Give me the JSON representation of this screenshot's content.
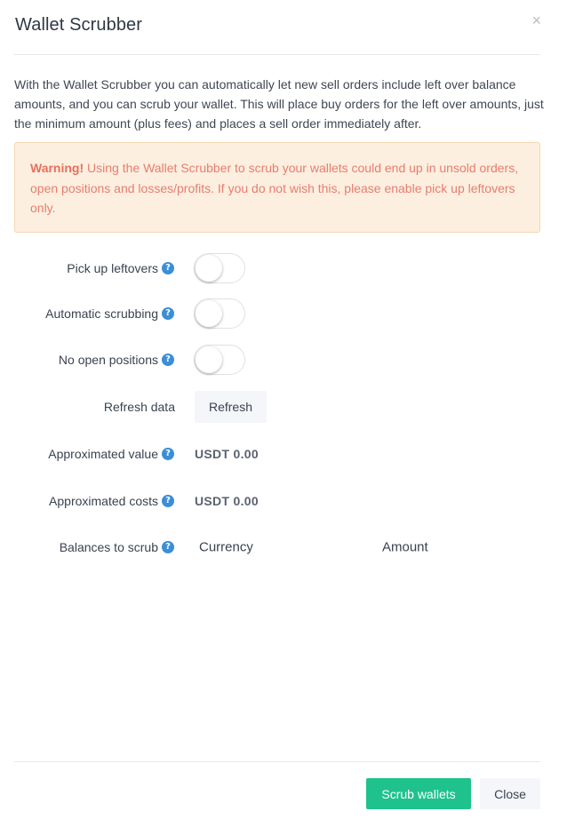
{
  "modal": {
    "title": "Wallet Scrubber",
    "close_glyph": "×"
  },
  "intro": {
    "text": "With the Wallet Scrubber you can automatically let new sell orders include left over balance amounts, and you can scrub your wallet. This will place buy orders for the left over amounts, just the minimum amount (plus fees) and places a sell order immediately after."
  },
  "warning": {
    "strong": "Warning!",
    "text": " Using the Wallet Scrubber to scrub your wallets could end up in unsold orders, open positions and losses/profits. If you do not wish this, please enable pick up leftovers only."
  },
  "form": {
    "pick_up_leftovers": {
      "label": "Pick up leftovers",
      "enabled": false
    },
    "automatic_scrubbing": {
      "label": "Automatic scrubbing",
      "enabled": false
    },
    "no_open_positions": {
      "label": "No open positions",
      "enabled": false
    },
    "refresh_data": {
      "label": "Refresh data",
      "button": "Refresh"
    },
    "approximated_value": {
      "label": "Approximated value",
      "value": "USDT 0.00"
    },
    "approximated_costs": {
      "label": "Approximated costs",
      "value": "USDT 0.00"
    },
    "balances_to_scrub": {
      "label": "Balances to scrub",
      "columns": [
        "Currency",
        "Amount"
      ]
    }
  },
  "help_glyph": "?",
  "footer": {
    "primary_label": "Scrub wallets",
    "secondary_label": "Close"
  },
  "colors": {
    "primary": "#1fc28c",
    "help_icon": "#3b8ed8",
    "warning_bg": "#fcefdf",
    "warning_text": "#e77d70"
  }
}
